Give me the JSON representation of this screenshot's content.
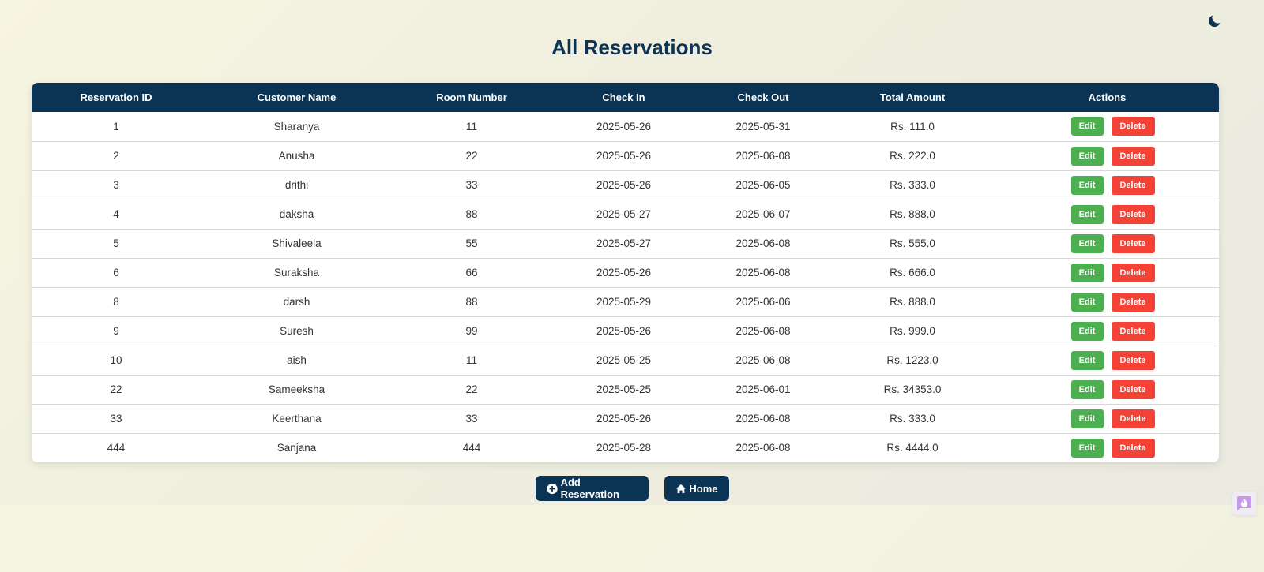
{
  "page": {
    "title": "All Reservations",
    "theme_icon": "moon-icon",
    "widget_icon": "chat-flame-icon"
  },
  "table": {
    "headers": [
      "Reservation ID",
      "Customer Name",
      "Room Number",
      "Check In",
      "Check Out",
      "Total Amount",
      "Actions"
    ],
    "rows": [
      {
        "id": "1",
        "name": "Sharanya",
        "room": "11",
        "check_in": "2025-05-26",
        "check_out": "2025-05-31",
        "amount": "Rs. 111.0"
      },
      {
        "id": "2",
        "name": "Anusha",
        "room": "22",
        "check_in": "2025-05-26",
        "check_out": "2025-06-08",
        "amount": "Rs. 222.0"
      },
      {
        "id": "3",
        "name": "drithi",
        "room": "33",
        "check_in": "2025-05-26",
        "check_out": "2025-06-05",
        "amount": "Rs. 333.0"
      },
      {
        "id": "4",
        "name": "daksha",
        "room": "88",
        "check_in": "2025-05-27",
        "check_out": "2025-06-07",
        "amount": "Rs. 888.0"
      },
      {
        "id": "5",
        "name": "Shivaleela",
        "room": "55",
        "check_in": "2025-05-27",
        "check_out": "2025-06-08",
        "amount": "Rs. 555.0"
      },
      {
        "id": "6",
        "name": "Suraksha",
        "room": "66",
        "check_in": "2025-05-26",
        "check_out": "2025-06-08",
        "amount": "Rs. 666.0"
      },
      {
        "id": "8",
        "name": "darsh",
        "room": "88",
        "check_in": "2025-05-29",
        "check_out": "2025-06-06",
        "amount": "Rs. 888.0"
      },
      {
        "id": "9",
        "name": "Suresh",
        "room": "99",
        "check_in": "2025-05-26",
        "check_out": "2025-06-08",
        "amount": "Rs. 999.0"
      },
      {
        "id": "10",
        "name": "aish",
        "room": "11",
        "check_in": "2025-05-25",
        "check_out": "2025-06-08",
        "amount": "Rs. 1223.0"
      },
      {
        "id": "22",
        "name": "Sameeksha",
        "room": "22",
        "check_in": "2025-05-25",
        "check_out": "2025-06-01",
        "amount": "Rs. 34353.0"
      },
      {
        "id": "33",
        "name": "Keerthana",
        "room": "33",
        "check_in": "2025-05-26",
        "check_out": "2025-06-08",
        "amount": "Rs. 333.0"
      },
      {
        "id": "444",
        "name": "Sanjana",
        "room": "444",
        "check_in": "2025-05-28",
        "check_out": "2025-06-08",
        "amount": "Rs. 4444.0"
      }
    ],
    "edit_label": "Edit",
    "delete_label": "Delete"
  },
  "actions": {
    "add_label": "Add Reservation",
    "add_icon": "plus-circle-icon",
    "home_label": "Home",
    "home_icon": "home-icon"
  },
  "colors": {
    "primary": "#0b3353",
    "edit": "#4caf50",
    "delete": "#f44336"
  }
}
